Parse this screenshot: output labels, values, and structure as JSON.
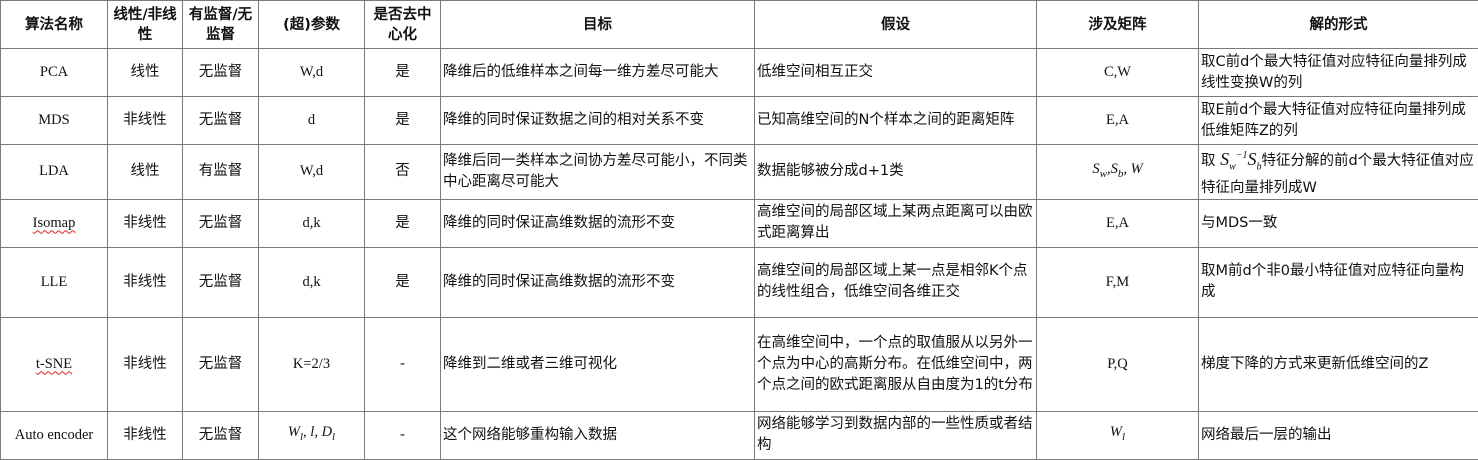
{
  "headers": [
    "算法名称",
    "线性/非线性",
    "有监督/无监督",
    "(超)参数",
    "是否去中心化",
    "目标",
    "假设",
    "涉及矩阵",
    "解的形式"
  ],
  "rows": [
    {
      "name": "PCA",
      "linearity": "线性",
      "supervision": "无监督",
      "params": "W,d",
      "centered": "是",
      "goal": "降维后的低维样本之间每一维方差尽可能大",
      "assumption": "低维空间相互正交",
      "matrices": "C,W",
      "solution": "取C前d个最大特征值对应特征向量排列成线性变换W的列"
    },
    {
      "name": "MDS",
      "linearity": "非线性",
      "supervision": "无监督",
      "params": "d",
      "centered": "是",
      "goal": "降维的同时保证数据之间的相对关系不变",
      "assumption": "已知高维空间的N个样本之间的距离矩阵",
      "matrices": "E,A",
      "solution": "取E前d个最大特征值对应特征向量排列成低维矩阵Z的列"
    },
    {
      "name": "LDA",
      "linearity": "线性",
      "supervision": "有监督",
      "params": "W,d",
      "centered": "否",
      "goal": "降维后同一类样本之间协方差尽可能小，不同类中心距离尽可能大",
      "assumption": "数据能够被分成d+1类",
      "matrices_math": {
        "a": "S",
        "a_sub": "w",
        "b": "S",
        "b_sub": "b",
        "c": "W"
      },
      "solution_prefix": "取",
      "solution_math": {
        "a": "S",
        "a_sub": "w",
        "a_sup": "−1",
        "b": "S",
        "b_sub": "b"
      },
      "solution_suffix": "特征分解的前d个最大特征值对应特征向量排列成W"
    },
    {
      "name": "Isomap",
      "linearity": "非线性",
      "supervision": "无监督",
      "params": "d,k",
      "centered": "是",
      "goal": "降维的同时保证高维数据的流形不变",
      "assumption": "高维空间的局部区域上某两点距离可以由欧式距离算出",
      "matrices": "E,A",
      "solution": "与MDS一致"
    },
    {
      "name": "LLE",
      "linearity": "非线性",
      "supervision": "无监督",
      "params": "d,k",
      "centered": "是",
      "goal": "降维的同时保证高维数据的流形不变",
      "assumption": "高维空间的局部区域上某一点是相邻K个点的线性组合，低维空间各维正交",
      "matrices": "F,M",
      "solution": "取M前d个非0最小特征值对应特征向量构成"
    },
    {
      "name": "t-SNE",
      "linearity": "非线性",
      "supervision": "无监督",
      "params": "K=2/3",
      "centered": "-",
      "goal": "降维到二维或者三维可视化",
      "assumption": "在高维空间中，一个点的取值服从以另外一个点为中心的高斯分布。在低维空间中，两个点之间的欧式距离服从自由度为1的t分布",
      "matrices": "P,Q",
      "solution": "梯度下降的方式来更新低维空间的Z"
    },
    {
      "name": "Auto encoder",
      "linearity": "非线性",
      "supervision": "无监督",
      "params_math": {
        "a": "W",
        "a_sub": "l",
        "b": "l",
        "c": "D",
        "c_sub": "l"
      },
      "centered": "-",
      "goal": "这个网络能够重构输入数据",
      "assumption": "网络能够学习到数据内部的一些性质或者结构",
      "matrices_math": {
        "a": "W",
        "a_sub": "l"
      },
      "solution": "网络最后一层的输出"
    }
  ]
}
